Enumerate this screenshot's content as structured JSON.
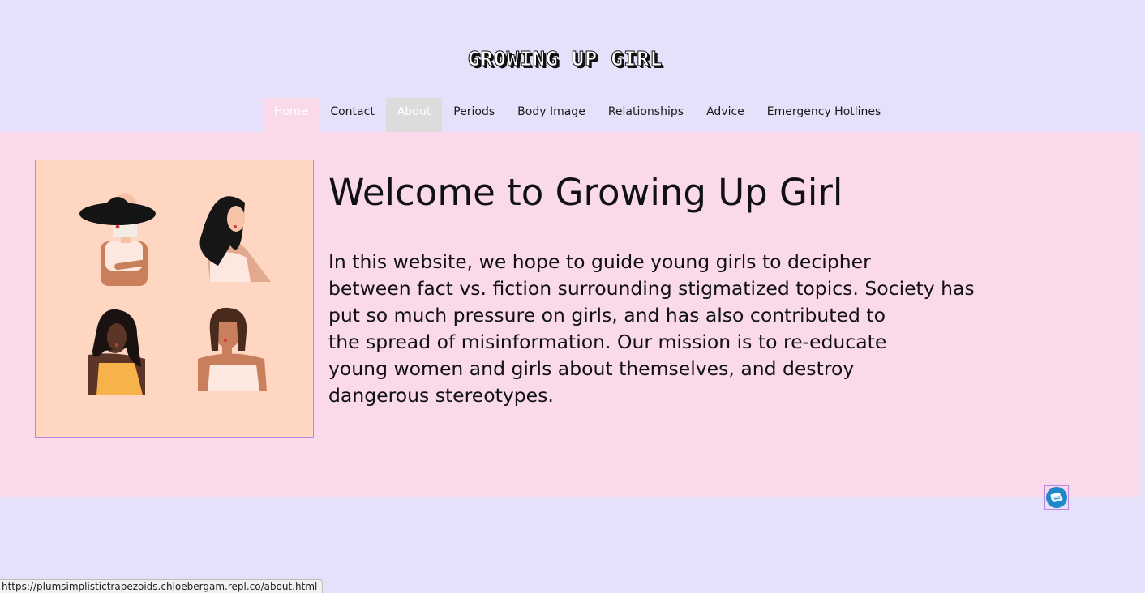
{
  "header": {
    "logo_text": "GROWING UP GIRL"
  },
  "nav": {
    "items": [
      {
        "label": "Home",
        "state": "active"
      },
      {
        "label": "Contact",
        "state": "normal"
      },
      {
        "label": "About",
        "state": "hover"
      },
      {
        "label": "Periods",
        "state": "normal"
      },
      {
        "label": "Body Image",
        "state": "normal"
      },
      {
        "label": "Relationships",
        "state": "normal"
      },
      {
        "label": "Advice",
        "state": "normal"
      },
      {
        "label": "Emergency Hotlines",
        "state": "normal"
      }
    ]
  },
  "main": {
    "heading": "Welcome to Growing Up Girl",
    "intro_lines": [
      "In this website, we hope to guide young girls to decipher",
      "between fact vs. fiction surrounding stigmatized topics. Society has",
      "put so much pressure on girls, and has also contributed to",
      "the spread of misinformation. Our mission is to re-educate",
      "young women and girls about themselves, and destroy",
      "dangerous stereotypes."
    ],
    "illustration_icon": "four-women-illustration"
  },
  "widget": {
    "icon": "chat-widget-icon"
  },
  "status_bar": {
    "url": "https://plumsimplistictrapezoids.chloebergam.repl.co/about.html"
  },
  "colors": {
    "page_background": "#e6e1fb",
    "band_background": "#f9d9ea",
    "illustration_background": "#ffd6c2",
    "hover_tab": "#dcdcdc",
    "widget_blue": "#1f88c9"
  }
}
